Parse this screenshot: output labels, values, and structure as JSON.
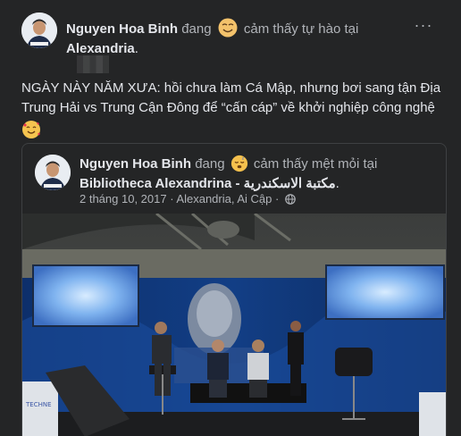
{
  "post": {
    "author": "Nguyen Hoa Binh",
    "verb": "đang",
    "feeling_emoji": "proud-face",
    "feeling_text": "cảm thấy tự hào tại",
    "location": "Alexandria",
    "location_suffix": ".",
    "more_label": "···",
    "text": "NGÀY NÀY NĂM XƯA: hồi chưa làm Cá Mập, nhưng bơi sang tận Địa Trung Hải vs Trung Cận Đông để “cấn cáp” về khởi nghiệp công nghệ",
    "text_emoji": "smiling-face-with-hearts"
  },
  "shared_post": {
    "author": "Nguyen Hoa Binh",
    "verb": "đang",
    "feeling_emoji": "tired-face",
    "feeling_text": "cảm thấy mệt mỏi tại",
    "location": "Bibliotheca Alexandrina - مكتبة الاسكندرية",
    "location_suffix": ".",
    "meta": "2 tháng 10, 2017 · Alexandria, Ai Cập ·",
    "privacy_icon": "globe-icon",
    "photo_description_icon": "stage-photo"
  },
  "colors": {
    "background": "#242526",
    "text": "#e4e6eb",
    "muted": "#b0b3b8",
    "border": "#3e4042"
  }
}
